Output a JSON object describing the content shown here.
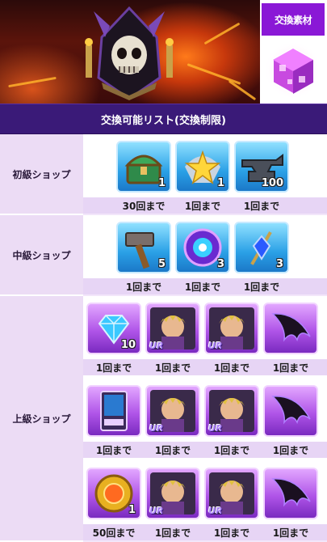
{
  "banner": {
    "tag_label": "交換素材"
  },
  "list_title": "交換可能リスト(交換制限)",
  "shops": [
    {
      "name": "初級ショップ",
      "items": [
        {
          "icon": "treasure-chest-icon",
          "qty": "1",
          "limit": "30回まで",
          "frame": "blue"
        },
        {
          "icon": "star-trophy-icon",
          "qty": "1",
          "limit": "1回まで",
          "frame": "blue"
        },
        {
          "icon": "anvil-icon",
          "qty": "100",
          "limit": "1回まで",
          "frame": "blue"
        }
      ]
    },
    {
      "name": "中級ショップ",
      "items": [
        {
          "icon": "hammer-icon",
          "qty": "5",
          "limit": "1回まで",
          "frame": "blue"
        },
        {
          "icon": "orb-icon",
          "qty": "3",
          "limit": "1回まで",
          "frame": "blue"
        },
        {
          "icon": "gem-scepter-icon",
          "qty": "3",
          "limit": "1回まで",
          "frame": "blue"
        }
      ]
    },
    {
      "name": "上級ショップ",
      "items": [
        {
          "icon": "diamond-icon",
          "qty": "10",
          "limit": "1回まで",
          "frame": "purple"
        },
        {
          "icon": "character-portrait-icon",
          "badge": "UR",
          "limit": "1回まで",
          "frame": "purple"
        },
        {
          "icon": "character-portrait-icon",
          "badge": "UR",
          "limit": "1回まで",
          "frame": "purple"
        },
        {
          "icon": "dark-wing-icon",
          "limit": "1回まで",
          "frame": "purple"
        },
        {
          "icon": "card-icon",
          "qty": "",
          "limit": "1回まで",
          "frame": "purple"
        },
        {
          "icon": "character-portrait-icon",
          "badge": "UR",
          "limit": "1回まで",
          "frame": "purple"
        },
        {
          "icon": "character-portrait-icon",
          "badge": "UR",
          "limit": "1回まで",
          "frame": "purple"
        },
        {
          "icon": "dark-wing-icon",
          "limit": "1回まで",
          "frame": "purple"
        },
        {
          "icon": "gold-medal-icon",
          "qty": "1",
          "limit": "50回まで",
          "frame": "purple"
        },
        {
          "icon": "character-portrait-icon",
          "badge": "UR",
          "limit": "1回まで",
          "frame": "purple"
        },
        {
          "icon": "character-portrait-icon",
          "badge": "UR",
          "limit": "1回まで",
          "frame": "purple"
        },
        {
          "icon": "dark-wing-icon",
          "limit": "1回まで",
          "frame": "purple"
        }
      ]
    }
  ],
  "colors": {
    "accent_purple": "#8a18d6",
    "header_bg": "#3a1a78",
    "label_bg": "#ecdcf5",
    "count_strip_bg": "#e7d5f5"
  }
}
